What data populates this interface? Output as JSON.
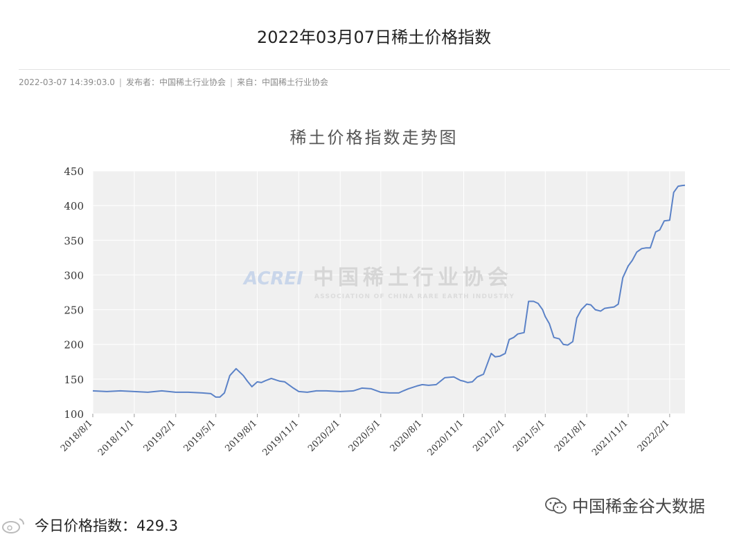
{
  "article": {
    "title": "2022年03月07日稀土价格指数",
    "date": "2022-03-07 14:39:03.0",
    "publisher": "发布者：中国稀土行业协会",
    "source": "来自：中国稀土行业协会",
    "today_label": "今日价格指数：",
    "today_value": "429.3"
  },
  "watermark": {
    "logo_text": "ACREI",
    "org_name": "中国稀土行业协会",
    "org_name_en": "ASSOCIATION OF CHINA RARE EARTH INDUSTRY",
    "brand": "中国稀金谷大数据",
    "icon": "wechat-icon"
  },
  "colors": {
    "line": "#5b82c7",
    "plot_bg": "#f0f0f0",
    "grid": "#ffffff"
  },
  "chart_data": {
    "type": "line",
    "title": "稀土价格指数走势图",
    "xlabel": "",
    "ylabel": "",
    "ylim": [
      100,
      450
    ],
    "yticks": [
      100,
      150,
      200,
      250,
      300,
      350,
      400,
      450
    ],
    "xticks": [
      "2018/8/1",
      "2018/11/1",
      "2019/2/1",
      "2019/5/1",
      "2019/8/1",
      "2019/11/1",
      "2020/2/1",
      "2020/5/1",
      "2020/8/1",
      "2020/11/1",
      "2021/2/1",
      "2021/5/1",
      "2021/8/1",
      "2021/11/1",
      "2022/2/1"
    ],
    "x_range": [
      "2018/8/1",
      "2022/3/7"
    ],
    "grid": true,
    "legend": "none",
    "series": [
      {
        "x": [
          "2018/8/1",
          "2018/9/1",
          "2018/10/1",
          "2018/11/1",
          "2018/12/1",
          "2019/1/1",
          "2019/2/1",
          "2019/3/1",
          "2019/4/1",
          "2019/4/20",
          "2019/5/1",
          "2019/5/10",
          "2019/5/20",
          "2019/6/1",
          "2019/6/15",
          "2019/7/1",
          "2019/7/10",
          "2019/7/20",
          "2019/8/1",
          "2019/8/10",
          "2019/8/20",
          "2019/9/1",
          "2019/9/20",
          "2019/10/1",
          "2019/10/20",
          "2019/11/1",
          "2019/11/20",
          "2019/12/10",
          "2020/1/1",
          "2020/2/1",
          "2020/3/1",
          "2020/3/20",
          "2020/4/10",
          "2020/5/1",
          "2020/5/20",
          "2020/6/10",
          "2020/6/20",
          "2020/7/1",
          "2020/7/20",
          "2020/8/1",
          "2020/8/15",
          "2020/9/1",
          "2020/9/20",
          "2020/10/10",
          "2020/10/25",
          "2020/11/1",
          "2020/11/10",
          "2020/11/20",
          "2020/12/1",
          "2020/12/15",
          "2021/1/1",
          "2021/1/10",
          "2021/1/20",
          "2021/2/1",
          "2021/2/10",
          "2021/2/20",
          "2021/3/1",
          "2021/3/15",
          "2021/3/25",
          "2021/4/5",
          "2021/4/15",
          "2021/4/25",
          "2021/5/1",
          "2021/5/10",
          "2021/5/20",
          "2021/6/1",
          "2021/6/10",
          "2021/6/20",
          "2021/7/1",
          "2021/7/10",
          "2021/7/20",
          "2021/8/1",
          "2021/8/10",
          "2021/8/20",
          "2021/9/1",
          "2021/9/10",
          "2021/9/20",
          "2021/10/1",
          "2021/10/10",
          "2021/10/20",
          "2021/11/1",
          "2021/11/10",
          "2021/11/20",
          "2021/12/1",
          "2021/12/10",
          "2021/12/20",
          "2022/1/1",
          "2022/1/10",
          "2022/1/20",
          "2022/2/1",
          "2022/2/10",
          "2022/2/20",
          "2022/3/1",
          "2022/3/7"
        ],
        "y": [
          133,
          132,
          133,
          132,
          131,
          133,
          131,
          131,
          130,
          129,
          124,
          124,
          130,
          155,
          165,
          155,
          147,
          139,
          146,
          145,
          148,
          151,
          147,
          146,
          137,
          132,
          131,
          133,
          133,
          132,
          133,
          137,
          136,
          131,
          130,
          130,
          133,
          136,
          140,
          142,
          141,
          142,
          152,
          153,
          148,
          147,
          145,
          146,
          153,
          157,
          187,
          182,
          183,
          187,
          207,
          210,
          215,
          217,
          262,
          262,
          259,
          250,
          240,
          230,
          210,
          208,
          200,
          199,
          204,
          238,
          250,
          258,
          257,
          250,
          248,
          252,
          253,
          254,
          258,
          296,
          313,
          321,
          333,
          338,
          339,
          339,
          362,
          365,
          378,
          379,
          419,
          428,
          429,
          429.3
        ]
      }
    ]
  }
}
